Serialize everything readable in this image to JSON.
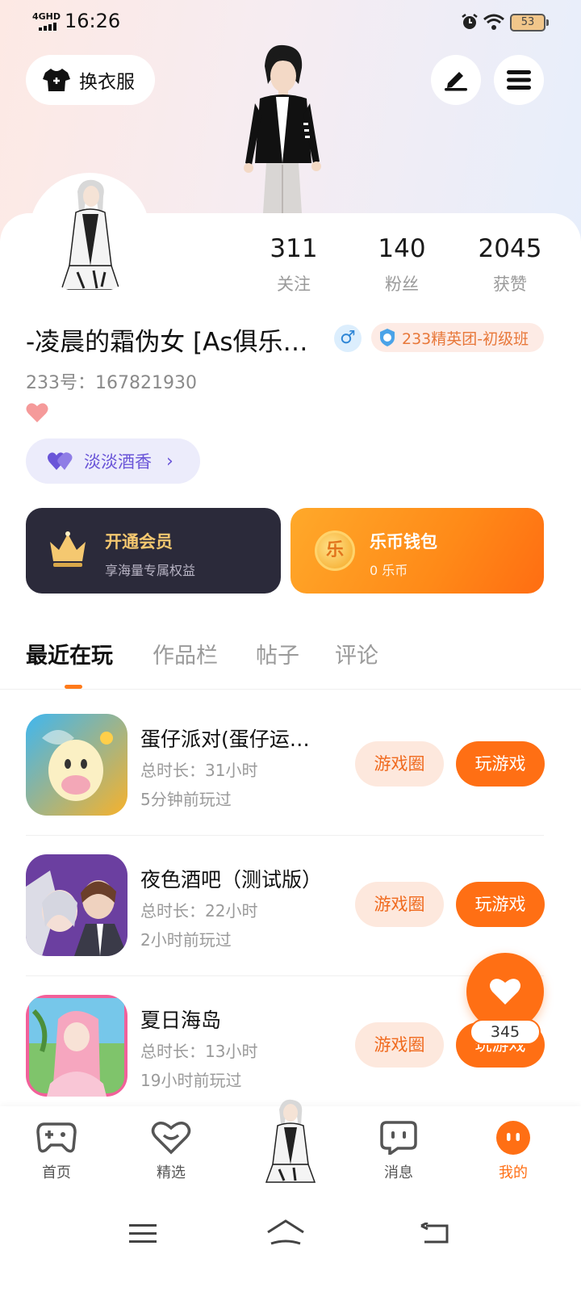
{
  "status_bar": {
    "network": "4GHD",
    "time": "16:26",
    "battery": "53"
  },
  "header": {
    "outfit_label": "换衣服"
  },
  "profile": {
    "stats": [
      {
        "value": "311",
        "label": "关注"
      },
      {
        "value": "140",
        "label": "粉丝"
      },
      {
        "value": "2045",
        "label": "获赞"
      }
    ],
    "username": "-凌晨的霜伪女 [As俱乐…",
    "gender_symbol": "♂",
    "badge": "233精英团-初级班",
    "uid": "233号：167821930",
    "tag_label": "淡淡酒香"
  },
  "cards": {
    "vip": {
      "title": "开通会员",
      "subtitle": "享海量专属权益"
    },
    "wallet": {
      "title": "乐币钱包",
      "subtitle": "0 乐币",
      "coin_char": "乐"
    }
  },
  "tabs": [
    "最近在玩",
    "作品栏",
    "帖子",
    "评论"
  ],
  "games": [
    {
      "name": "蛋仔派对(蛋仔运…",
      "duration": "总时长：31小时",
      "last_played": "5分钟前玩过",
      "circle_label": "游戏圈",
      "play_label": "玩游戏"
    },
    {
      "name": "夜色酒吧（测试版）",
      "duration": "总时长：22小时",
      "last_played": "2小时前玩过",
      "circle_label": "游戏圈",
      "play_label": "玩游戏"
    },
    {
      "name": "夏日海岛",
      "duration": "总时长：13小时",
      "last_played": "19小时前玩过",
      "circle_label": "游戏圈",
      "play_label": "玩游戏"
    }
  ],
  "like_count": "345",
  "bottom_nav": [
    {
      "label": "首页"
    },
    {
      "label": "精选"
    },
    {
      "label": "消息"
    },
    {
      "label": "我的"
    }
  ],
  "colors": {
    "accent": "#ff6f14",
    "vip_gold": "#f5c870",
    "badge_text": "#e8783a",
    "tag_purple": "#6a55d8"
  }
}
